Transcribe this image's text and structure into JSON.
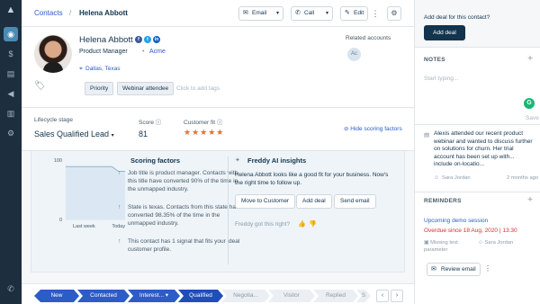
{
  "nav": {
    "items": [
      {
        "icon": "contacts-icon",
        "glyph": "◉",
        "active": true
      },
      {
        "icon": "deals-icon",
        "glyph": "$",
        "active": false
      },
      {
        "icon": "conversations-icon",
        "glyph": "▤",
        "active": false
      },
      {
        "icon": "campaigns-icon",
        "glyph": "◀",
        "active": false
      },
      {
        "icon": "reports-icon",
        "glyph": "▥",
        "active": false
      },
      {
        "icon": "settings-icon",
        "glyph": "⚙",
        "active": false
      },
      {
        "icon": "phone-icon",
        "glyph": "✆",
        "active": false
      }
    ]
  },
  "header": {
    "breadcrumb": "Contacts",
    "separator": "/",
    "contact_name": "Helena Abbott",
    "email_label": "Email",
    "call_label": "Call",
    "edit_label": "Edit"
  },
  "profile": {
    "name": "Helena Abbott",
    "job_title": "Product Manager",
    "dot": "•",
    "company": "Acme",
    "location": "Dallas, Texas",
    "tags": [
      "Priority",
      "Webinar attendee"
    ],
    "add_tags_placeholder": "Click to add tags",
    "related_accounts_title": "Related accounts",
    "related_account_initials": "Ac"
  },
  "scoring": {
    "lifecycle_label": "Lifecycle stage",
    "lifecycle_value": "Sales Qualified Lead",
    "score_label": "Score",
    "score_value": "81",
    "fit_label": "Customer fit",
    "fit_stars": "★★★★★",
    "hide_link": "Hide scoring factors"
  },
  "factors": {
    "title": "Scoring factors",
    "items": [
      "Job title is product manager. Contacts with this title have converted 90% of the time in the unmapped industry.",
      "State is texas. Contacts from this state have converted 98.35% of the time in the unmapped industry.",
      "This contact has 1 signal that fits your ideal customer profile."
    ]
  },
  "ai": {
    "title": "Freddy AI insights",
    "message": "Helena Abbott looks like a good fit for your business. Now's the right time to follow up.",
    "buttons": [
      "Move to Customer",
      "Add deal",
      "Send email"
    ],
    "feedback_question": "Freddy got this right?"
  },
  "chart_data": {
    "type": "line",
    "x": [
      "Last week",
      "Today"
    ],
    "y_ticks": [
      100,
      0
    ],
    "ylim": [
      0,
      100
    ],
    "series": [
      {
        "values": [
          89,
          89,
          89,
          89,
          89,
          89,
          89,
          89,
          81,
          81
        ]
      }
    ]
  },
  "pipeline": {
    "stages": [
      {
        "label": "New",
        "state": "done"
      },
      {
        "label": "Contacted",
        "state": "done"
      },
      {
        "label": "Interest... ▾",
        "state": "done"
      },
      {
        "label": "Qualified",
        "state": "current"
      },
      {
        "label": "Negotia...",
        "state": "todo"
      },
      {
        "label": "Visitor",
        "state": "todo"
      },
      {
        "label": "Replied",
        "state": "todo"
      },
      {
        "label": "S",
        "state": "todo"
      }
    ],
    "prev": "‹",
    "next": "›"
  },
  "right_panel": {
    "deal_question": "Add deal for this contact?",
    "add_deal_button": "Add deal",
    "notes_title": "NOTES",
    "note_placeholder": "Start typing...",
    "save_label": "Save",
    "note_text": "Alexis attended our recent product webinar and wanted to discuss further on solutions for churn. Her trial account has been set up with... include on-locatio...",
    "note_author": "Sara Jordan",
    "note_time": "2 months ago",
    "reminders_title": "REMINDERS",
    "reminder_title": "Upcoming demo session",
    "reminder_due": "Overdue since 18 Aug, 2020 | 13:30",
    "reminder_param": "Missing text parameter",
    "reminder_owner": "Sara Jordan",
    "review_email_label": "Review email",
    "g_badge": "G"
  },
  "colors": {
    "accent": "#2c5cc5",
    "nav_bg": "#1d2e3f",
    "stars": "#e86f25",
    "overdue": "#d72d30",
    "chart_line": "#8fb3d6"
  }
}
